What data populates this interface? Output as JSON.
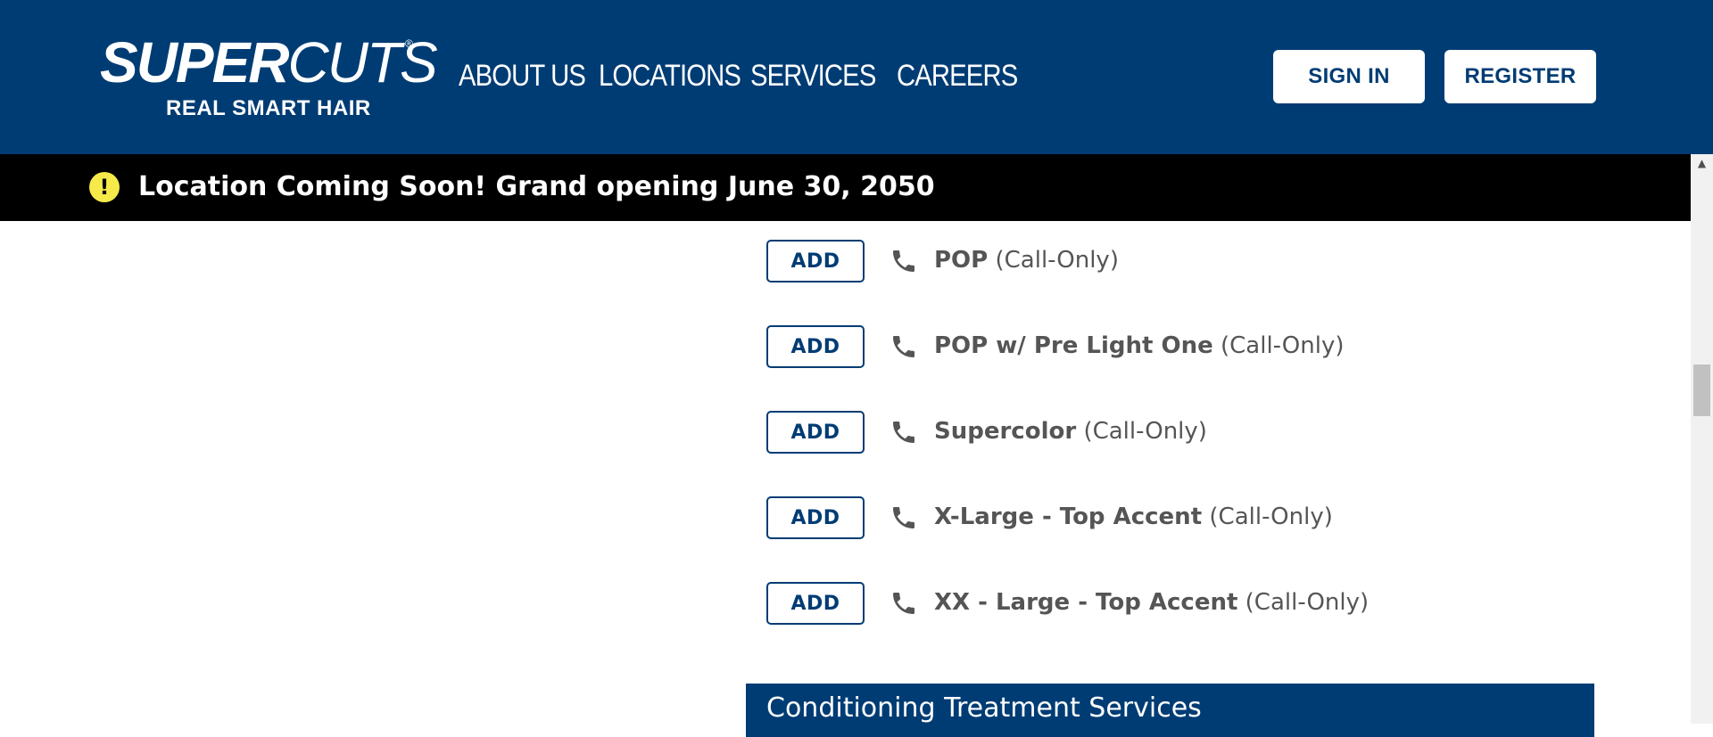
{
  "brand": {
    "logo_main_bold": "SUPER",
    "logo_main_thin": "CUTS",
    "logo_registered": "®",
    "tagline": "REAL SMART HAIR"
  },
  "nav": {
    "items": [
      {
        "label": "ABOUT US"
      },
      {
        "label": "LOCATIONS"
      },
      {
        "label": "SERVICES"
      },
      {
        "label": "CAREERS"
      }
    ]
  },
  "header_buttons": {
    "sign_in": "SIGN IN",
    "register": "REGISTER"
  },
  "alert": {
    "icon": "exclamation-icon",
    "text": "Location Coming Soon! Grand opening June 30, 2050"
  },
  "services": [
    {
      "add_label": "ADD",
      "icon": "phone-icon",
      "name": "POP",
      "note": "(Call-Only)"
    },
    {
      "add_label": "ADD",
      "icon": "phone-icon",
      "name": "POP w/ Pre Light One",
      "note": "(Call-Only)"
    },
    {
      "add_label": "ADD",
      "icon": "phone-icon",
      "name": "Supercolor",
      "note": "(Call-Only)"
    },
    {
      "add_label": "ADD",
      "icon": "phone-icon",
      "name": "X-Large - Top Accent",
      "note": "(Call-Only)"
    },
    {
      "add_label": "ADD",
      "icon": "phone-icon",
      "name": "XX - Large - Top Accent",
      "note": "(Call-Only)"
    }
  ],
  "next_section": {
    "title": "Conditioning Treatment Services"
  },
  "colors": {
    "brand_blue": "#003c74",
    "alert_bg": "#000000",
    "alert_icon": "#f5ea4a",
    "service_text": "#555555"
  }
}
